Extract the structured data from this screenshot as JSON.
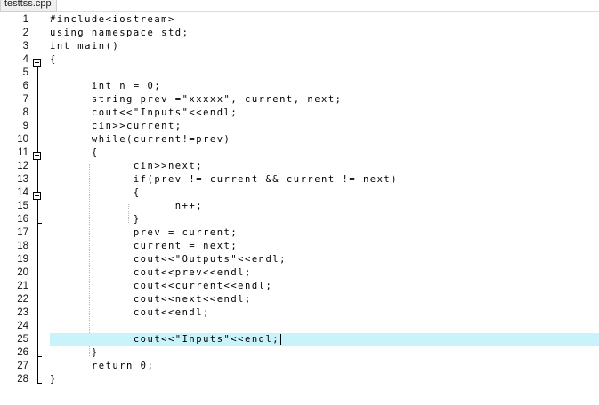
{
  "tab": {
    "filename": "testtss.cpp"
  },
  "editor": {
    "current_line": 25,
    "lines": [
      {
        "n": "1",
        "code": "#include<iostream>"
      },
      {
        "n": "2",
        "code": "using namespace std;"
      },
      {
        "n": "3",
        "code": "int main()"
      },
      {
        "n": "4",
        "code": "{"
      },
      {
        "n": "5",
        "code": ""
      },
      {
        "n": "6",
        "code": "      int n = 0;"
      },
      {
        "n": "7",
        "code": "      string prev =\"xxxxx\", current, next;"
      },
      {
        "n": "8",
        "code": "      cout<<\"Inputs\"<<endl;"
      },
      {
        "n": "9",
        "code": "      cin>>current;"
      },
      {
        "n": "10",
        "code": "      while(current!=prev)"
      },
      {
        "n": "11",
        "code": "      {"
      },
      {
        "n": "12",
        "code": "            cin>>next;"
      },
      {
        "n": "13",
        "code": "            if(prev != current && current != next)"
      },
      {
        "n": "14",
        "code": "            {"
      },
      {
        "n": "15",
        "code": "                  n++;"
      },
      {
        "n": "16",
        "code": "            }"
      },
      {
        "n": "17",
        "code": "            prev = current;"
      },
      {
        "n": "18",
        "code": "            current = next;"
      },
      {
        "n": "19",
        "code": "            cout<<\"Outputs\"<<endl;"
      },
      {
        "n": "20",
        "code": "            cout<<prev<<endl;"
      },
      {
        "n": "21",
        "code": "            cout<<current<<endl;"
      },
      {
        "n": "22",
        "code": "            cout<<next<<endl;"
      },
      {
        "n": "23",
        "code": "            cout<<endl;"
      },
      {
        "n": "24",
        "code": ""
      },
      {
        "n": "25",
        "code": "            cout<<\"Inputs\"<<endl;"
      },
      {
        "n": "26",
        "code": "      }"
      },
      {
        "n": "27",
        "code": "      return 0;"
      },
      {
        "n": "28",
        "code": "}"
      }
    ]
  },
  "colors": {
    "current_line_bg": "#c9f3fb"
  }
}
